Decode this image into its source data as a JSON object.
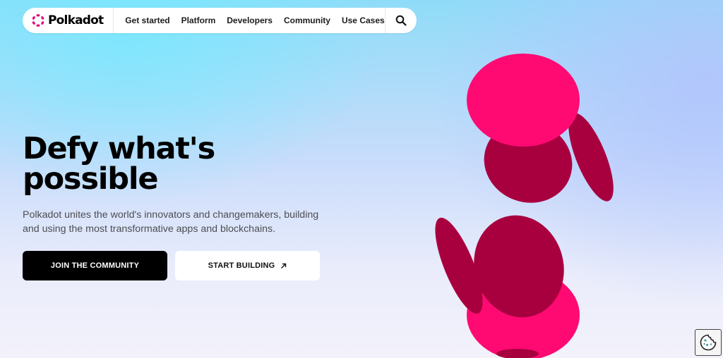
{
  "brand": {
    "name": "Polkadot",
    "accent": "#E6007A"
  },
  "nav": {
    "links": [
      "Get started",
      "Platform",
      "Developers",
      "Community",
      "Use Cases"
    ],
    "search_icon": "search-icon"
  },
  "hero": {
    "title_line1": "Defy what's",
    "title_line2": "possible",
    "subtitle": "Polkadot unites the world's innovators and changemakers, building and using the most transformative apps and blockchains.",
    "primary_cta": "JOIN THE COMMUNITY",
    "secondary_cta": "START BUILDING",
    "secondary_cta_icon": "arrow-up-right-icon"
  },
  "decor": {
    "disc_bright": "#FF0A73",
    "disc_dark": "#A8003F"
  },
  "cookie_widget": {
    "icon": "cookie-icon"
  }
}
